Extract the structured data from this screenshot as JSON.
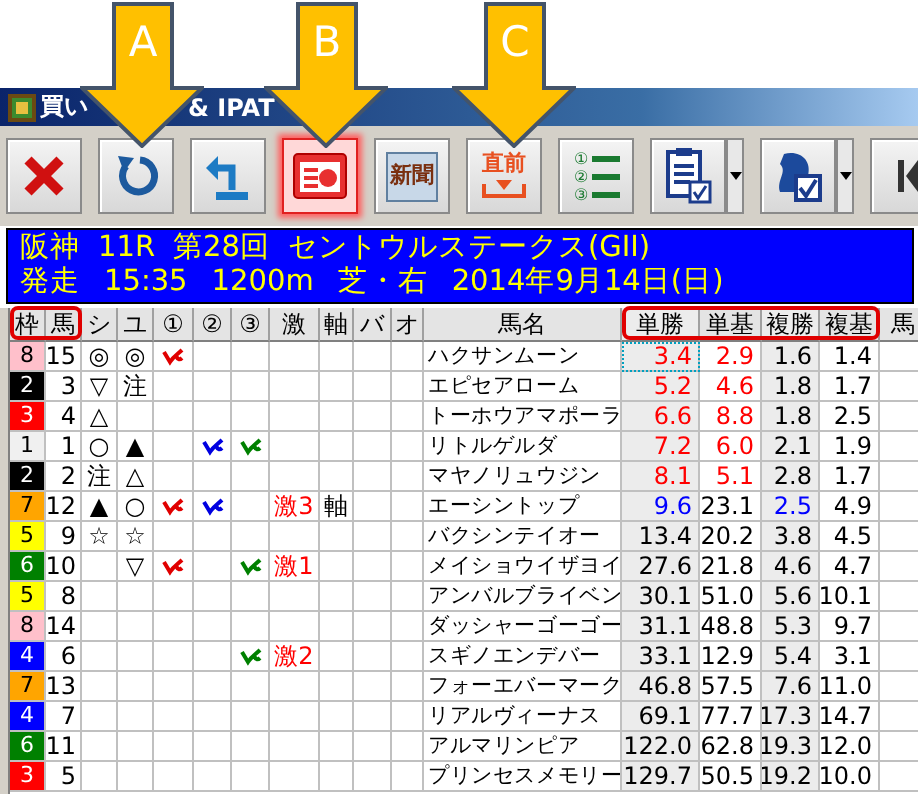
{
  "window": {
    "title_parts": [
      "買い",
      "& IPAT"
    ]
  },
  "callouts": [
    {
      "label": "A"
    },
    {
      "label": "B"
    },
    {
      "label": "C"
    }
  ],
  "toolbar": [
    {
      "kind": "close",
      "pressed": false,
      "dropdown": false
    },
    {
      "kind": "undo",
      "pressed": false,
      "dropdown": false
    },
    {
      "kind": "return",
      "pressed": false,
      "dropdown": false
    },
    {
      "kind": "card",
      "pressed": true,
      "dropdown": false
    },
    {
      "kind": "newspaper",
      "icon_text": "新聞",
      "pressed": false,
      "dropdown": false
    },
    {
      "kind": "latest",
      "icon_text": "直前",
      "pressed": false,
      "dropdown": false
    },
    {
      "kind": "list",
      "icon_text": "①②③",
      "pressed": false,
      "dropdown": false
    },
    {
      "kind": "clipboard",
      "pressed": false,
      "dropdown": true
    },
    {
      "kind": "horse",
      "pressed": false,
      "dropdown": true
    },
    {
      "kind": "first",
      "pressed": false,
      "dropdown": false
    }
  ],
  "race": {
    "line1": [
      "阪神",
      "11R",
      "第28回",
      "セントウルステークス(GII)"
    ],
    "line2": [
      "発走",
      "15:35",
      "1200m",
      "芝・右",
      "2014年9月14日(日)"
    ]
  },
  "table": {
    "columns": [
      {
        "label": "枠",
        "highlighted": true,
        "shaded": false
      },
      {
        "label": "馬",
        "highlighted": true,
        "shaded": false
      },
      {
        "label": "シ",
        "highlighted": false,
        "shaded": false
      },
      {
        "label": "ユ",
        "highlighted": false,
        "shaded": false
      },
      {
        "label": "①",
        "highlighted": false,
        "shaded": false
      },
      {
        "label": "②",
        "highlighted": false,
        "shaded": false
      },
      {
        "label": "③",
        "highlighted": false,
        "shaded": false
      },
      {
        "label": "激",
        "highlighted": false,
        "shaded": false
      },
      {
        "label": "軸",
        "highlighted": false,
        "shaded": false
      },
      {
        "label": "バ",
        "highlighted": false,
        "shaded": false
      },
      {
        "label": "オ",
        "highlighted": false,
        "shaded": false
      },
      {
        "label": "馬名",
        "highlighted": false,
        "shaded": false
      },
      {
        "label": "単勝",
        "highlighted": true,
        "shaded": true
      },
      {
        "label": "単基",
        "highlighted": true,
        "shaded": false
      },
      {
        "label": "複勝",
        "highlighted": true,
        "shaded": true
      },
      {
        "label": "複基",
        "highlighted": true,
        "shaded": false
      },
      {
        "label": "馬",
        "highlighted": false,
        "shaded": false
      }
    ],
    "rows": [
      {
        "waku": "8",
        "color": "#ffc0cb",
        "num": "15",
        "shi": "◎",
        "yu": "◎",
        "picks": [
          true,
          false,
          false
        ],
        "name": "ハクサンムーン",
        "focused": true,
        "odds": [
          {
            "text": "3.4",
            "color": "#ff0000"
          },
          {
            "text": "2.9",
            "color": "#ff0000"
          },
          {
            "text": "1.6",
            "color": "#000000"
          },
          {
            "text": "1.4",
            "color": "#000000"
          }
        ]
      },
      {
        "waku": "2",
        "color": "#000000",
        "num": "3",
        "shi": "▽",
        "yu": "注",
        "picks": [
          false,
          false,
          false
        ],
        "name": "エピセアローム",
        "focused": false,
        "odds": [
          {
            "text": "5.2",
            "color": "#ff0000"
          },
          {
            "text": "4.6",
            "color": "#ff0000"
          },
          {
            "text": "1.8",
            "color": "#000000"
          },
          {
            "text": "1.7",
            "color": "#000000"
          }
        ]
      },
      {
        "waku": "3",
        "color": "#ff0000",
        "num": "4",
        "shi": "△",
        "picks": [
          false,
          false,
          false
        ],
        "name": "トーホウアマポーラ",
        "focused": false,
        "odds": [
          {
            "text": "6.6",
            "color": "#ff0000"
          },
          {
            "text": "8.8",
            "color": "#ff0000"
          },
          {
            "text": "1.8",
            "color": "#000000"
          },
          {
            "text": "2.5",
            "color": "#000000"
          }
        ]
      },
      {
        "waku": "1",
        "color": "#f0f0f0",
        "num": "1",
        "shi": "○",
        "yu": "▲",
        "picks": [
          false,
          true,
          true
        ],
        "name": "リトルゲルダ",
        "focused": false,
        "odds": [
          {
            "text": "7.2",
            "color": "#ff0000"
          },
          {
            "text": "6.0",
            "color": "#ff0000"
          },
          {
            "text": "2.1",
            "color": "#000000"
          },
          {
            "text": "1.9",
            "color": "#000000"
          }
        ]
      },
      {
        "waku": "2",
        "color": "#000000",
        "num": "2",
        "shi": "注",
        "yu": "△",
        "picks": [
          false,
          false,
          false
        ],
        "name": "マヤノリュウジン",
        "focused": false,
        "odds": [
          {
            "text": "8.1",
            "color": "#ff0000"
          },
          {
            "text": "5.1",
            "color": "#ff0000"
          },
          {
            "text": "2.8",
            "color": "#000000"
          },
          {
            "text": "1.7",
            "color": "#000000"
          }
        ]
      },
      {
        "waku": "7",
        "color": "#ffa500",
        "num": "12",
        "shi": "▲",
        "yu": "○",
        "picks": [
          true,
          true,
          false
        ],
        "geki": "激3",
        "jiku": "軸",
        "name": "エーシントップ",
        "focused": false,
        "odds": [
          {
            "text": "9.6",
            "color": "#0000ff"
          },
          {
            "text": "23.1",
            "color": "#000000"
          },
          {
            "text": "2.5",
            "color": "#0000ff"
          },
          {
            "text": "4.9",
            "color": "#000000"
          }
        ]
      },
      {
        "waku": "5",
        "color": "#ffff00",
        "num": "9",
        "shi": "☆",
        "yu": "☆",
        "picks": [
          false,
          false,
          false
        ],
        "name": "バクシンテイオー",
        "focused": false,
        "odds": [
          {
            "text": "13.4",
            "color": "#000000"
          },
          {
            "text": "20.2",
            "color": "#000000"
          },
          {
            "text": "3.8",
            "color": "#000000"
          },
          {
            "text": "4.5",
            "color": "#000000"
          }
        ]
      },
      {
        "waku": "6",
        "color": "#008000",
        "num": "10",
        "yu": "▽",
        "picks": [
          true,
          false,
          true
        ],
        "geki": "激1",
        "name": "メイショウイザヨイ",
        "focused": false,
        "odds": [
          {
            "text": "27.6",
            "color": "#000000"
          },
          {
            "text": "21.8",
            "color": "#000000"
          },
          {
            "text": "4.6",
            "color": "#000000"
          },
          {
            "text": "4.7",
            "color": "#000000"
          }
        ]
      },
      {
        "waku": "5",
        "color": "#ffff00",
        "num": "8",
        "picks": [
          false,
          false,
          false
        ],
        "name": "アンバルブライベン",
        "focused": false,
        "odds": [
          {
            "text": "30.1",
            "color": "#000000"
          },
          {
            "text": "51.0",
            "color": "#000000"
          },
          {
            "text": "5.6",
            "color": "#000000"
          },
          {
            "text": "10.1",
            "color": "#000000"
          }
        ]
      },
      {
        "waku": "8",
        "color": "#ffc0cb",
        "num": "14",
        "picks": [
          false,
          false,
          false
        ],
        "name": "ダッシャーゴーゴー",
        "focused": false,
        "odds": [
          {
            "text": "31.1",
            "color": "#000000"
          },
          {
            "text": "48.8",
            "color": "#000000"
          },
          {
            "text": "5.3",
            "color": "#000000"
          },
          {
            "text": "9.7",
            "color": "#000000"
          }
        ]
      },
      {
        "waku": "4",
        "color": "#0000ff",
        "num": "6",
        "picks": [
          false,
          false,
          true
        ],
        "geki": "激2",
        "name": "スギノエンデバー",
        "focused": false,
        "odds": [
          {
            "text": "33.1",
            "color": "#000000"
          },
          {
            "text": "12.9",
            "color": "#000000"
          },
          {
            "text": "5.4",
            "color": "#000000"
          },
          {
            "text": "3.1",
            "color": "#000000"
          }
        ]
      },
      {
        "waku": "7",
        "color": "#ffa500",
        "num": "13",
        "picks": [
          false,
          false,
          false
        ],
        "name": "フォーエバーマーク",
        "focused": false,
        "odds": [
          {
            "text": "46.8",
            "color": "#000000"
          },
          {
            "text": "57.5",
            "color": "#000000"
          },
          {
            "text": "7.6",
            "color": "#000000"
          },
          {
            "text": "11.0",
            "color": "#000000"
          }
        ]
      },
      {
        "waku": "4",
        "color": "#0000ff",
        "num": "7",
        "picks": [
          false,
          false,
          false
        ],
        "name": "リアルヴィーナス",
        "focused": false,
        "odds": [
          {
            "text": "69.1",
            "color": "#000000"
          },
          {
            "text": "77.7",
            "color": "#000000"
          },
          {
            "text": "17.3",
            "color": "#000000"
          },
          {
            "text": "14.7",
            "color": "#000000"
          }
        ]
      },
      {
        "waku": "6",
        "color": "#008000",
        "num": "11",
        "picks": [
          false,
          false,
          false
        ],
        "name": "アルマリンピア",
        "focused": false,
        "odds": [
          {
            "text": "122.0",
            "color": "#000000"
          },
          {
            "text": "62.8",
            "color": "#000000"
          },
          {
            "text": "19.3",
            "color": "#000000"
          },
          {
            "text": "12.0",
            "color": "#000000"
          }
        ]
      },
      {
        "waku": "3",
        "color": "#ff0000",
        "num": "5",
        "picks": [
          false,
          false,
          false
        ],
        "name": "プリンセスメモリー",
        "focused": false,
        "odds": [
          {
            "text": "129.7",
            "color": "#000000"
          },
          {
            "text": "50.5",
            "color": "#000000"
          },
          {
            "text": "19.2",
            "color": "#000000"
          },
          {
            "text": "10.0",
            "color": "#000000"
          }
        ]
      }
    ]
  }
}
